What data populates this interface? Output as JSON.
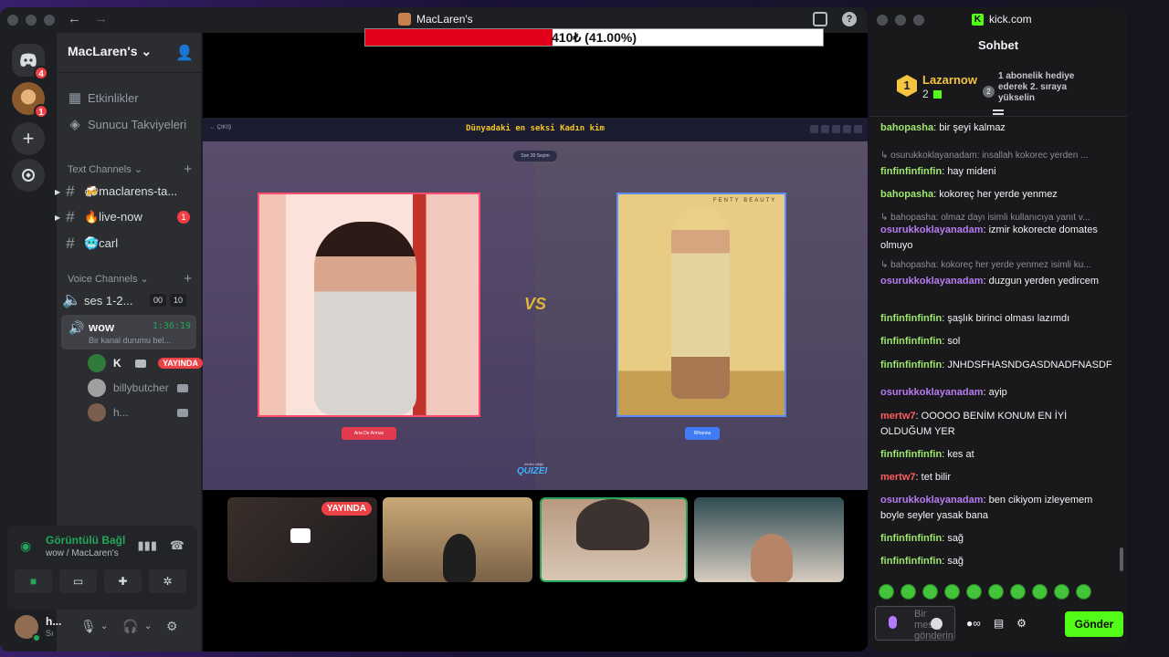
{
  "discord": {
    "window_title": "MacLaren's",
    "server_name": "MacLaren's",
    "badges": {
      "discord_unread": "4",
      "maclarens_unread": "1"
    },
    "nav": {
      "events": "Etkinlikler",
      "boosts": "Sunucu Takviyeleri"
    },
    "text_category": "Text Channels",
    "text_channels": [
      {
        "label": "🍻maclarens-ta..."
      },
      {
        "label": "🔥live-now",
        "count": "1"
      },
      {
        "label": "🥶carl"
      }
    ],
    "voice_category": "Voice Channels",
    "voice_channels": [
      {
        "label": "ses 1-2...",
        "a": "00",
        "b": "10"
      },
      {
        "label": "wow",
        "timer": "1:36:19",
        "status": "Bir kanal durumu bel..."
      }
    ],
    "voice_users": [
      {
        "name": "K",
        "live": "YAYINDA"
      },
      {
        "name": "billybutcher"
      },
      {
        "name": "h..."
      }
    ],
    "voice_panel": {
      "title": "Görüntülü Bağl",
      "subtitle": "wow / MacLaren's"
    },
    "user": {
      "name": "h...",
      "status": "Sı"
    }
  },
  "overlay": {
    "progress_text": "410₺ (41.00%)",
    "progress_fraction": 0.41
  },
  "quiz": {
    "title": "Dünyadaki en seksi Kadın kim",
    "back": "← ÇIKIŞ",
    "round": "Son 20 Seçim",
    "left_name": "Ana De Armas",
    "right_name": "Rihanna",
    "vs": "VS",
    "brand_small": "neden değil",
    "brand": "QUIZEI",
    "backdrop_text": "FENTY BEAUTY"
  },
  "tiles": {
    "live_badge": "YAYINDA"
  },
  "chat": {
    "site": "kick.com",
    "header": "Sohbet",
    "pinned": {
      "rank": "1",
      "user": "Lazarnow",
      "count": "2",
      "rank2": "2",
      "message": "1 abonelik hediye ederek 2. sıraya yükselin"
    },
    "messages": [
      {
        "user": "bahopasha",
        "color": "#9ee86b",
        "text": "bir şeyi kalmaz"
      },
      {
        "reply": "osurukkoklayanadam: insallah kokorec yerden ..."
      },
      {
        "user": "finfinfinfinfin",
        "color": "#9ee86b",
        "text": "hay mideni"
      },
      {
        "user": "bahopasha",
        "color": "#9ee86b",
        "text": "kokoreç her yerde yenmez"
      },
      {
        "reply": "bahopasha: olmaz dayı isimli kullanıcıya yanıt v..."
      },
      {
        "user": "osurukkoklayanadam",
        "color": "#b77bf0",
        "text": "izmir kokorecte domates olmuyo"
      },
      {
        "reply": "bahopasha: kokoreç her yerde yenmez isimli ku..."
      },
      {
        "user": "osurukkoklayanadam",
        "color": "#b77bf0",
        "text": "duzgun yerden yedircem"
      },
      {
        "user": "finfinfinfinfin",
        "color": "#9ee86b",
        "text": "şaşlık birinci olması lazımdı"
      },
      {
        "user": "finfinfinfinfin",
        "color": "#9ee86b",
        "text": "sol"
      },
      {
        "user": "finfinfinfinfin",
        "color": "#9ee86b",
        "text": "JNHDSFHASNDGASDNADFNASDF"
      },
      {
        "user": "osurukkoklayanadam",
        "color": "#b77bf0",
        "text": "ayip"
      },
      {
        "user": "mertw7",
        "color": "#ff5d5d",
        "text": "OOOOO BENİM KONUM EN İYİ OLDUĞUM YER"
      },
      {
        "user": "finfinfinfinfin",
        "color": "#9ee86b",
        "text": "kes at"
      },
      {
        "user": "mertw7",
        "color": "#ff5d5d",
        "text": "tet bilir"
      },
      {
        "user": "osurukkoklayanadam",
        "color": "#b77bf0",
        "text": "ben cikiyom izleyemem boyle seyler yasak bana"
      },
      {
        "user": "finfinfinfinfin",
        "color": "#9ee86b",
        "text": "sağ"
      },
      {
        "user": "finfinfinfinfin",
        "color": "#9ee86b",
        "text": "sağ"
      }
    ],
    "input_placeholder": "Bir mesaj gönderin",
    "send_label": "Gönder",
    "accent": "#53fc18"
  }
}
